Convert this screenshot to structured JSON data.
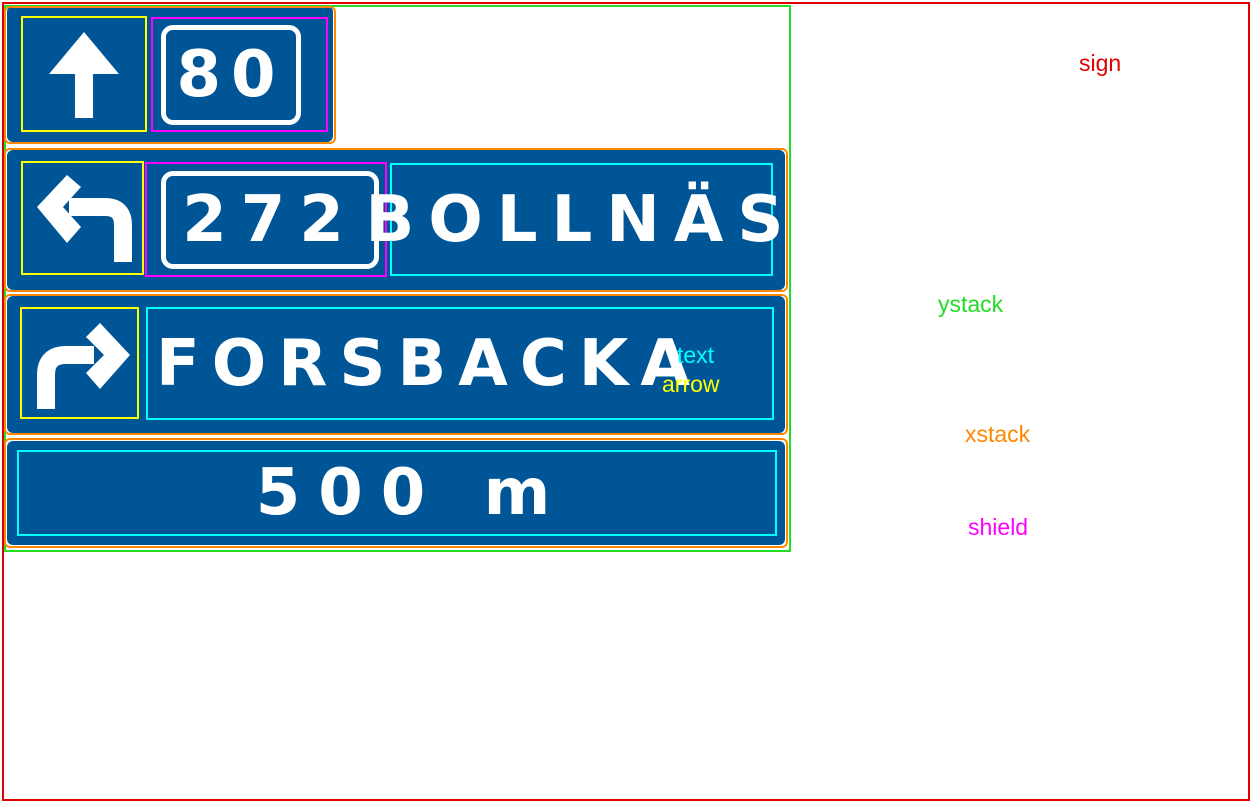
{
  "colors": {
    "sign": "#e00000",
    "ystack": "#22dd22",
    "xstack": "#ff8800",
    "shield": "#ff00ff",
    "text": "#00ffff",
    "arrow": "#ffff00",
    "panel_blue": "#005596"
  },
  "rows": [
    {
      "arrow_icon": "arrow-up-icon",
      "shield_number": "80"
    },
    {
      "arrow_icon": "arrow-turn-left-icon",
      "shield_number": "272",
      "destination": "BOLLNÄS"
    },
    {
      "arrow_icon": "arrow-turn-right-icon",
      "destination": "FORSBACKA"
    },
    {
      "distance": "500 m"
    }
  ],
  "legend": {
    "sign": "sign",
    "ystack": "ystack",
    "xstack": "xstack",
    "shield": "shield",
    "text": "text",
    "arrow": "arrow"
  }
}
